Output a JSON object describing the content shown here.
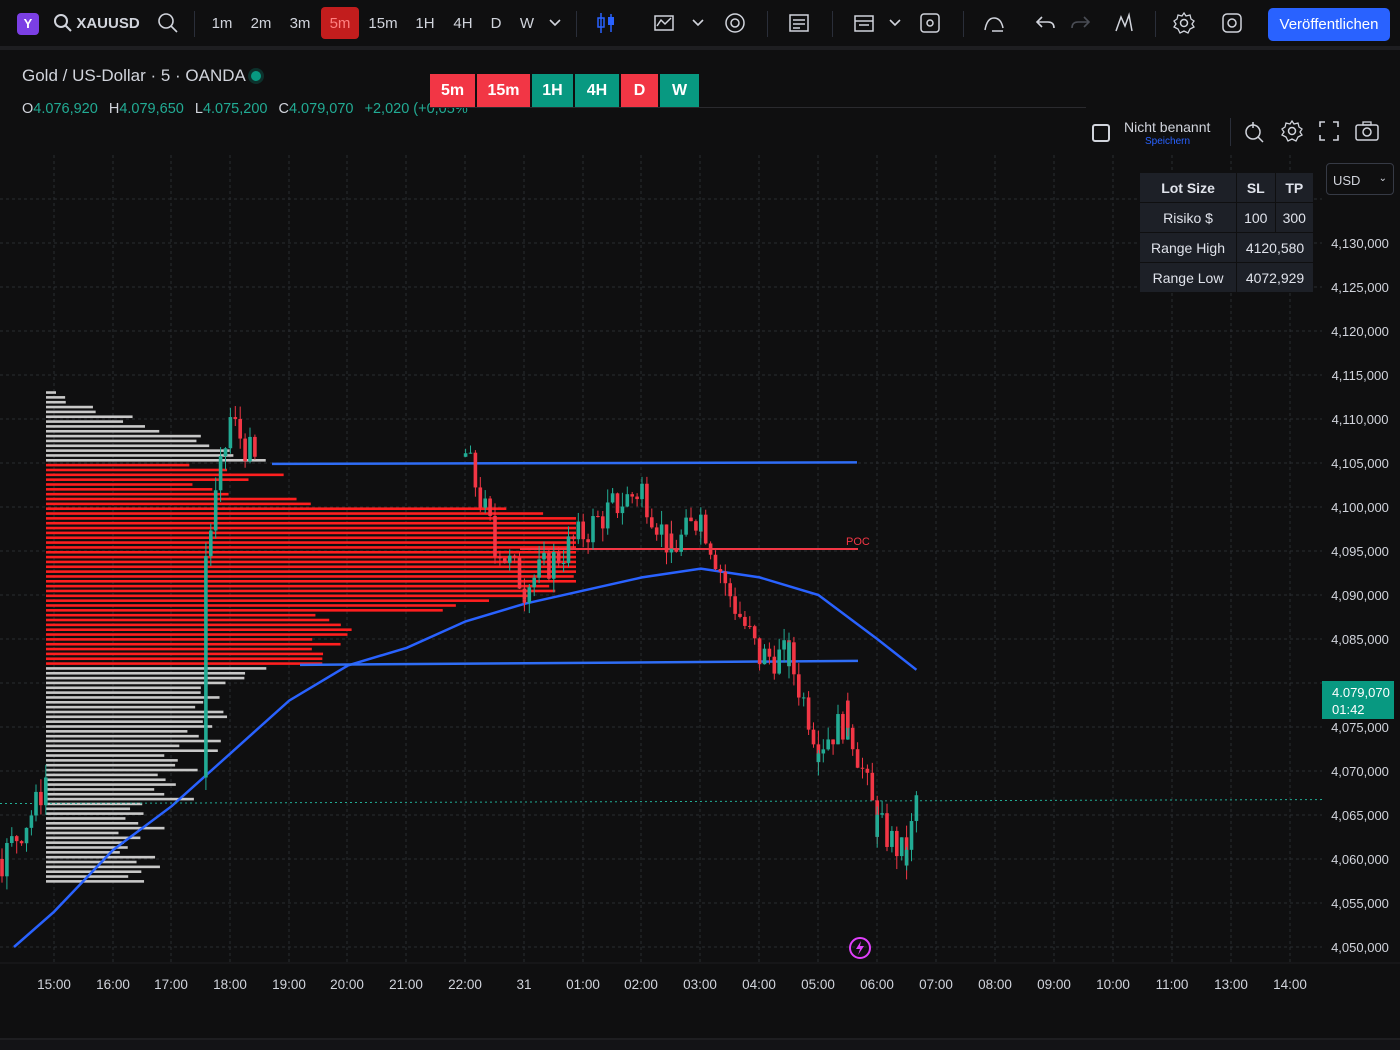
{
  "toolbar": {
    "symbol": "XAUUSD",
    "intervals": [
      "1m",
      "2m",
      "3m",
      "5m",
      "15m",
      "1H",
      "4H",
      "D",
      "W"
    ],
    "selected_interval": "5m",
    "publish_label": "Veröffentlichen",
    "logo": "Y"
  },
  "legend": {
    "title": "Gold / US-Dollar · 5 · OANDA",
    "open_label": "O",
    "open": "4.076,920",
    "high_label": "H",
    "high": "4.079,650",
    "low_label": "L",
    "low": "4.075,200",
    "close_label": "C",
    "close": "4.079,070",
    "change": "+2,020 (+0,05%",
    "timeframe_buttons": [
      {
        "label": "5m",
        "color": "red"
      },
      {
        "label": "15m",
        "color": "red"
      },
      {
        "label": "1H",
        "color": "green"
      },
      {
        "label": "4H",
        "color": "green"
      },
      {
        "label": "D",
        "color": "red"
      },
      {
        "label": "W",
        "color": "green"
      }
    ]
  },
  "layout_name": {
    "title": "Nicht benannt",
    "subtitle": "Speichern"
  },
  "currency": "USD",
  "info_table": {
    "headers": [
      "Lot Size",
      "SL",
      "TP"
    ],
    "risk_label": "Risiko $",
    "sl": "100",
    "tp": "300",
    "range_high_label": "Range High",
    "range_high": "4120,580",
    "range_low_label": "Range Low",
    "range_low": "4072,929"
  },
  "price_scale": {
    "ticks": [
      "4,130,000",
      "4,125,000",
      "4,120,000",
      "4,115,000",
      "4,110,000",
      "4,105,000",
      "4,100,000",
      "4,095,000",
      "4,090,000",
      "4,085,000",
      "4,075,000",
      "4,070,000",
      "4,065,000",
      "4,060,000",
      "4,055,000",
      "4,050,000"
    ],
    "current_price": "4.079,070",
    "countdown": "01:42"
  },
  "time_axis": [
    "15:00",
    "16:00",
    "17:00",
    "18:00",
    "19:00",
    "20:00",
    "21:00",
    "22:00",
    "31",
    "01:00",
    "02:00",
    "03:00",
    "04:00",
    "05:00",
    "06:00",
    "07:00",
    "08:00",
    "09:00",
    "10:00",
    "11:00",
    "13:00",
    "14:00"
  ],
  "poc_label": "POC",
  "colors": {
    "up": "#22ab94",
    "down": "#f23645",
    "ema": "#2962ff",
    "value_area": "#ff1f1f",
    "profile_outside": "#c8c8c8",
    "accent": "#2962ff"
  },
  "chart_data": {
    "type": "candlestick",
    "y_range": [
      4048,
      4133
    ],
    "time_range": [
      "14:05",
      "14:30"
    ],
    "levels": {
      "range_high_line": 4104.9,
      "range_low_line": 4082.4,
      "poc": 4095.0,
      "last_price": 4079.07
    },
    "candles_close_path": [
      {
        "t": "14:05",
        "c": 4060
      },
      {
        "t": "14:40",
        "c": 4066
      },
      {
        "t": "15:00",
        "c": 4072
      },
      {
        "t": "16:00",
        "c": 4068
      },
      {
        "t": "17:00",
        "c": 4073
      },
      {
        "t": "18:00",
        "c": 4110
      },
      {
        "t": "18:30",
        "c": 4104
      },
      {
        "t": "21:00",
        "c": 4103
      },
      {
        "t": "22:00",
        "c": 4106
      },
      {
        "t": "22:30",
        "c": 4096
      },
      {
        "t": "23:00",
        "c": 4091
      },
      {
        "t": "00:30",
        "c": 4100
      },
      {
        "t": "01:00",
        "c": 4102
      },
      {
        "t": "01:30",
        "c": 4095
      },
      {
        "t": "02:00",
        "c": 4099
      },
      {
        "t": "02:30",
        "c": 4090
      },
      {
        "t": "03:00",
        "c": 4083
      },
      {
        "t": "03:30",
        "c": 4083
      },
      {
        "t": "04:00",
        "c": 4073
      },
      {
        "t": "04:30",
        "c": 4076
      },
      {
        "t": "05:00",
        "c": 4064
      },
      {
        "t": "05:30",
        "c": 4060
      },
      {
        "t": "05:40",
        "c": 4067
      }
    ],
    "ema": [
      {
        "t": "14:05",
        "v": 4050
      },
      {
        "t": "15:00",
        "v": 4054
      },
      {
        "t": "16:00",
        "v": 4061
      },
      {
        "t": "17:00",
        "v": 4066
      },
      {
        "t": "18:00",
        "v": 4072
      },
      {
        "t": "19:00",
        "v": 4078
      },
      {
        "t": "20:00",
        "v": 4082
      },
      {
        "t": "21:00",
        "v": 4084
      },
      {
        "t": "22:00",
        "v": 4087
      },
      {
        "t": "23:00",
        "v": 4089
      },
      {
        "t": "01:00",
        "v": 4092
      },
      {
        "t": "02:00",
        "v": 4093
      },
      {
        "t": "03:00",
        "v": 4092
      },
      {
        "t": "04:00",
        "v": 4090
      },
      {
        "t": "05:00",
        "v": 4085
      },
      {
        "t": "05:40",
        "v": 4081.5
      }
    ]
  }
}
